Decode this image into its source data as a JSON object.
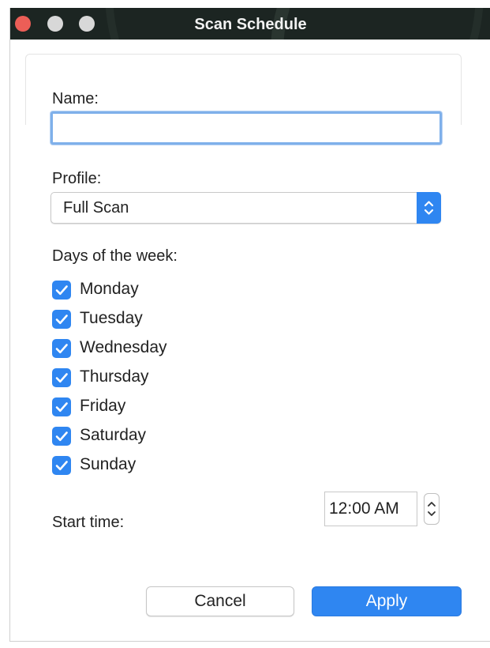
{
  "window": {
    "title": "Scan Schedule"
  },
  "form": {
    "name_label": "Name:",
    "name_value": "",
    "profile_label": "Profile:",
    "profile_value": "Full Scan",
    "days_label": "Days of the week:",
    "days": [
      {
        "label": "Monday",
        "checked": true
      },
      {
        "label": "Tuesday",
        "checked": true
      },
      {
        "label": "Wednesday",
        "checked": true
      },
      {
        "label": "Thursday",
        "checked": true
      },
      {
        "label": "Friday",
        "checked": true
      },
      {
        "label": "Saturday",
        "checked": true
      },
      {
        "label": "Sunday",
        "checked": true
      }
    ],
    "start_time_label": "Start time:",
    "start_time_value": "12:00 AM"
  },
  "buttons": {
    "cancel": "Cancel",
    "apply": "Apply"
  },
  "colors": {
    "accent": "#2f86f1",
    "close_button": "#ec5e57"
  },
  "icons": {
    "select_arrows": "chevron-up-down-icon",
    "checkbox": "checkmark-icon",
    "stepper": "stepper-arrows-icon"
  }
}
